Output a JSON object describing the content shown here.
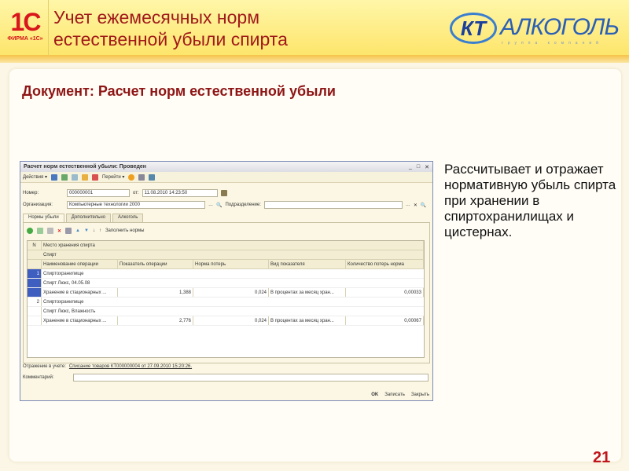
{
  "slide": {
    "title_line1": "Учет ежемесячных норм",
    "title_line2": "естественной убыли спирта",
    "logo_1c_text": "1С",
    "logo_1c_caption": "ФИРМА «1С»",
    "logo_kt": "КТ",
    "logo_kt_name": "АЛКОГОЛЬ",
    "logo_kt_sub": "группа компаний",
    "doc_title": "Документ: Расчет норм естественной убыли",
    "description": "Рассчитывает и отражает нормативную убыль спирта при хранении в спиртохранилищах и цистернах.",
    "page_number": "21"
  },
  "window": {
    "title": "Расчет норм естественной убыли: Проведен",
    "actions": "Действия ▾",
    "goto": "Перейти ▾",
    "number_label": "Номер:",
    "number": "000000001",
    "date_label": "от:",
    "date": "11.08.2010 14:23:50",
    "org_label": "Организация:",
    "org": "Компьютерные технологии 2000",
    "dept_label": "Подразделение:",
    "dept": "",
    "tabs": [
      "Нормы убыли",
      "Дополнительно",
      "Алкоголь"
    ],
    "fill_norms": "Заполнить нормы",
    "headers": {
      "n": "N",
      "storage": "Место хранения спирта",
      "spirit": "Спирт",
      "cols": [
        "Наименование операции",
        "Показатель операции",
        "Норма потерь",
        "Вид показателя",
        "Количество потерь норма"
      ]
    },
    "rows": [
      {
        "n": "1",
        "storage": "Спиртохранилище",
        "spirit": "Спирт Люкс, 04.05.08",
        "op": "Хранение в стационарных ...",
        "value": "1,388",
        "norm": "0,024",
        "kind": "В процентах за месяц хран...",
        "loss": "0,00033"
      },
      {
        "n": "2",
        "storage": "Спиртохранилище",
        "spirit": "Спирт Люкс, Влажность",
        "op": "Хранение в стационарных ...",
        "value": "2,776",
        "norm": "0,024",
        "kind": "В процентах за месяц хран...",
        "loss": "0,00067"
      }
    ],
    "reflect_label": "Отражение в учете:",
    "reflect_link": "Списание товаров КТ000000004 от 27.09.2010 15:20:26.",
    "comment_label": "Комментарий:",
    "comment": "",
    "ok": "OK",
    "save": "Записать",
    "close": "Закрыть"
  }
}
